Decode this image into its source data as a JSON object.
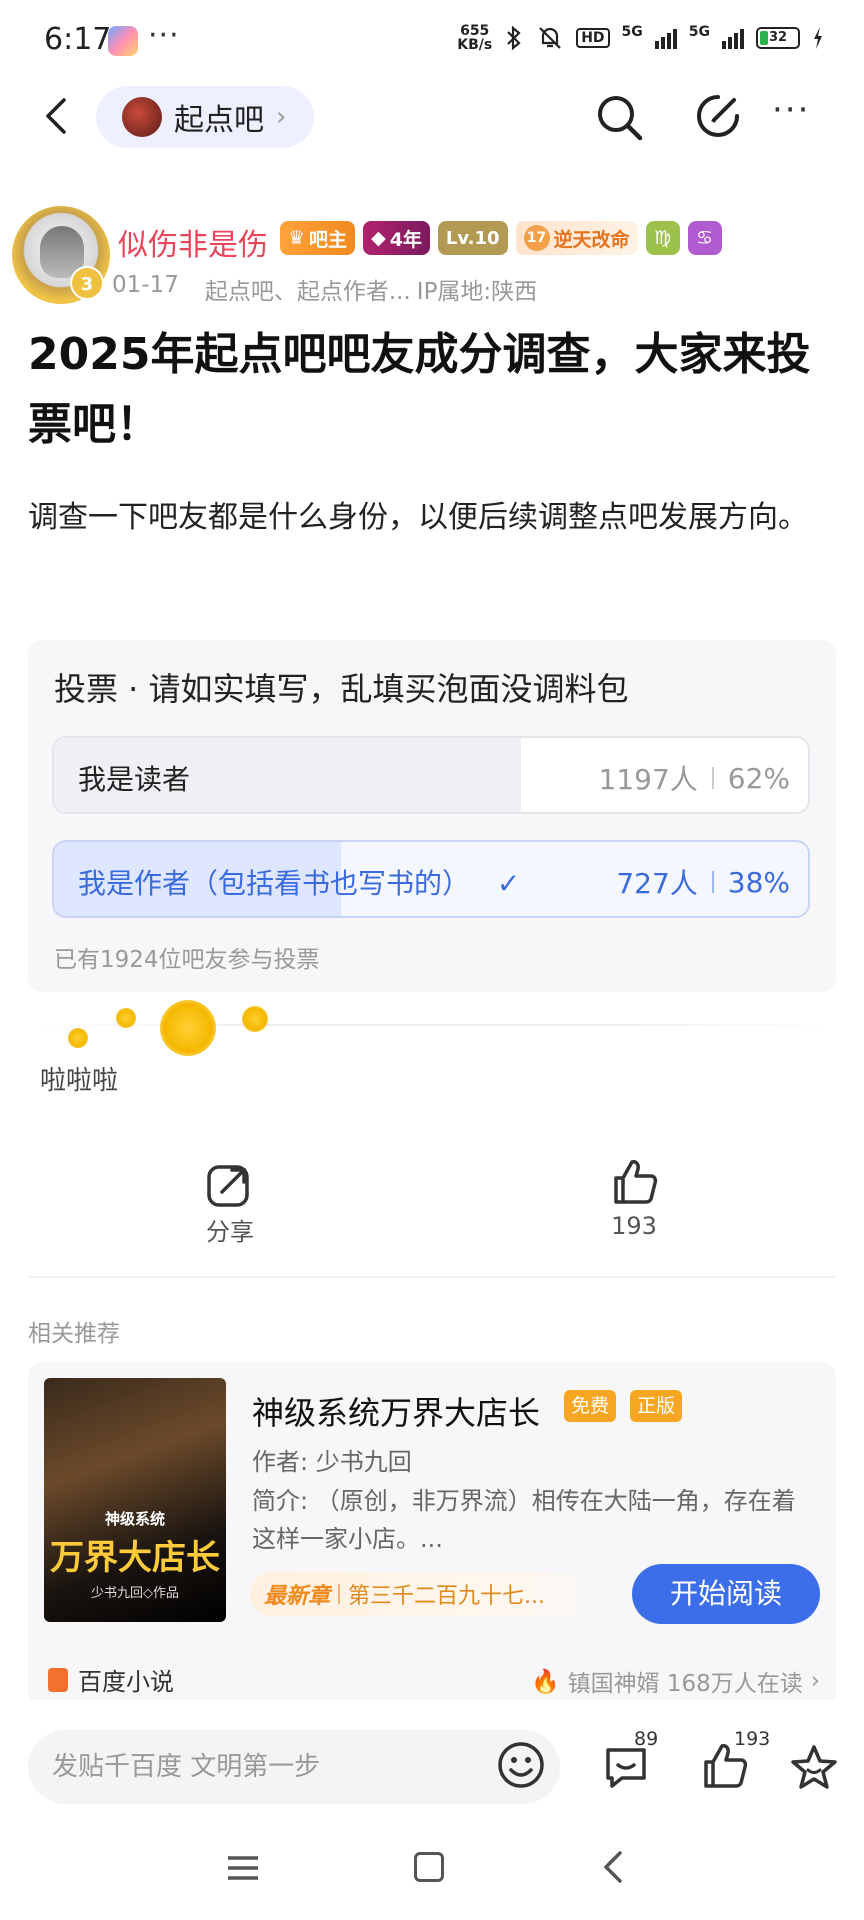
{
  "status_bar": {
    "time": "6:17",
    "more": "···",
    "speed_top": "655",
    "speed_bottom": "KB/s",
    "hd_label": "HD",
    "net1": "5G",
    "net2": "5G",
    "battery": "32"
  },
  "nav": {
    "forum_name": "起点吧",
    "forum_chevron": "›",
    "more": "···"
  },
  "author": {
    "name": "似伤非是伤",
    "level_badge": "3",
    "badge_bazhu": "吧主",
    "badge_years": "4年",
    "badge_lv": "Lv.10",
    "badge_title_num": "17",
    "badge_title_text": "逆天改命",
    "badge_zodiac1": "♍",
    "badge_zodiac2": "♋",
    "date": "01-17",
    "forums": "起点吧、起点作者...",
    "ip": "IP属地:陕西"
  },
  "post": {
    "title": "2025年起点吧吧友成分调查，大家来投票吧！",
    "body": "调查一下吧友都是什么身份，以便后续调整点吧发展方向。"
  },
  "vote": {
    "title": "投票 · 请如实填写，乱填买泡面没调料包",
    "options": [
      {
        "label": "我是读者",
        "count": "1197人",
        "percent": "62%",
        "share": 0.62,
        "selected": false
      },
      {
        "label": "我是作者（包括看书也写书的）",
        "check": "✓",
        "count": "727人",
        "percent": "38%",
        "share": 0.38,
        "selected": true
      }
    ],
    "total": "已有1924位吧友参与投票"
  },
  "comment": {
    "text": "啦啦啦"
  },
  "actions": {
    "share_label": "分享",
    "like_count": "193"
  },
  "recommend": {
    "label": "相关推荐",
    "book": {
      "cover_sub": "神级系统",
      "cover_main": "万界大店长",
      "cover_author": "少书九回◇作品",
      "title": "神级系统万界大店长",
      "tag_free": "免费",
      "tag_genuine": "正版",
      "author": "作者:  少书九回",
      "desc": "简介:  （原创，非万界流）相传在大陆一角，存在着这样一家小店。...",
      "latest_label": "最新章",
      "latest_chapter": "第三千二百九十七...",
      "read_button": "开始阅读",
      "source": "百度小说",
      "source_right": "镇国神婿 168万人在读",
      "source_chevron": "›"
    }
  },
  "bottom_bar": {
    "input_placeholder": "发贴千百度 文明第一步",
    "comment_count": "89",
    "like_count": "193"
  },
  "colors": {
    "accent_blue": "#3d6eea",
    "author_red": "#e8455a",
    "tag_orange": "#f6a623"
  }
}
